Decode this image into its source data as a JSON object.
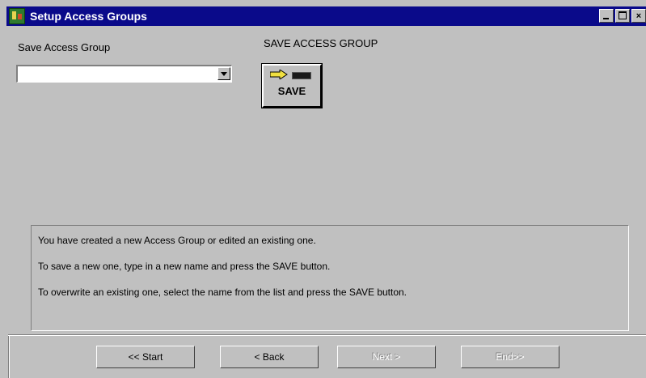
{
  "window": {
    "title": "Setup Access Groups",
    "controls": {
      "close": "×"
    }
  },
  "form": {
    "combo_label": "Save Access Group",
    "combo_value": "",
    "section_title": "SAVE ACCESS GROUP",
    "save_button_label": "SAVE"
  },
  "info": {
    "lines": [
      "You have created a new Access Group or edited an existing one.",
      "To save a new one,  type in a new name and press the SAVE button.",
      "To overwrite an existing one, select the name from the list and press the SAVE button."
    ]
  },
  "nav": {
    "start": "<< Start",
    "back": "< Back",
    "next": "Next >",
    "end": "End>>"
  },
  "colors": {
    "titlebar": "#0a0a8a",
    "face": "#c0c0c0",
    "arrow": "#f0e040"
  }
}
